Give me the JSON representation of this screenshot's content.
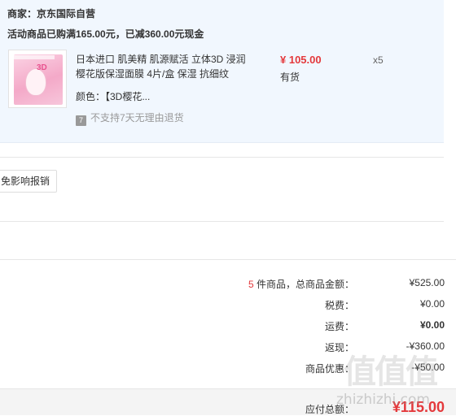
{
  "order": {
    "merchant": "商家：京东国际自营",
    "promo": "活动商品已购满165.00元，已减360.00元现金",
    "item": {
      "title": "日本进口 肌美精 肌源赋活 立体3D 浸润樱花版保湿面膜 4片/盒 保湿 抗细纹",
      "price": "¥ 105.00",
      "stock": "有货",
      "qty": "x5",
      "color_label": "颜色：【3D樱花...",
      "return_icon_text": "7",
      "return_policy": "不支持7天无理由退货",
      "thumb_text": "3D"
    }
  },
  "invoice_button": "免影响报销",
  "summary": {
    "count": "5",
    "count_text": " 件商品，总商品金额：",
    "goods_total": "¥525.00",
    "tax_label": "税费：",
    "tax": "¥0.00",
    "shipping_label": "运费：",
    "shipping": "¥0.00",
    "rebate_label": "返现：",
    "rebate": "-¥360.00",
    "discount_label": "商品优惠：",
    "discount": "-¥50.00",
    "payable_label": "应付总额：",
    "payable": "¥115.00"
  },
  "watermark": {
    "logo": "值值值",
    "url": "zhizhizhi.com"
  },
  "colors": {
    "accent": "#e4393c",
    "panel": "#f1f7fe"
  }
}
